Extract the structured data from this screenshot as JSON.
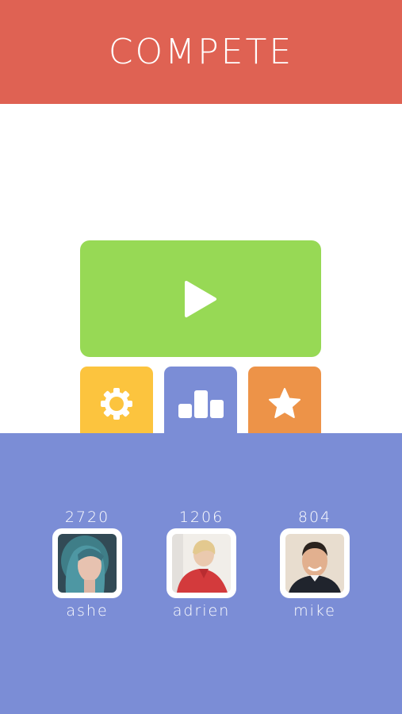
{
  "header": {
    "title": "COMPETE",
    "color": "#df6253"
  },
  "menu": {
    "play": {
      "icon": "play-icon",
      "color": "#97d955"
    },
    "settings": {
      "icon": "gear-icon",
      "color": "#fcc43e"
    },
    "leaderboard": {
      "icon": "bar-chart-icon",
      "color": "#7b8dd6",
      "selected": true
    },
    "favorites": {
      "icon": "star-icon",
      "color": "#ed9348"
    }
  },
  "leaderboard": {
    "background": "#7b8dd6",
    "players": [
      {
        "name": "ashe",
        "score": "2720"
      },
      {
        "name": "adrien",
        "score": "1206"
      },
      {
        "name": "mike",
        "score": "804"
      }
    ]
  }
}
